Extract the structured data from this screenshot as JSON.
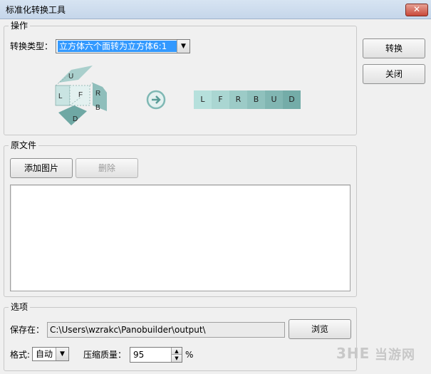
{
  "window": {
    "title": "标准化转换工具",
    "close_glyph": "✕"
  },
  "operation": {
    "group_title": "操作",
    "type_label": "转换类型：",
    "type_value": "立方体六个面转为立方体6:1",
    "cube_faces": {
      "up": "U",
      "left": "L",
      "front": "F",
      "right": "R",
      "back": "B",
      "down": "D"
    },
    "arrow_icon": "arrow-right-circle-icon",
    "strip_faces": [
      "L",
      "F",
      "R",
      "B",
      "U",
      "D"
    ],
    "strip_colors": [
      "#b6e0dc",
      "#aad6d2",
      "#9ccbc7",
      "#8fc1bd",
      "#81b6b2",
      "#74aca8"
    ]
  },
  "side_buttons": {
    "convert": "转换",
    "close": "关闭"
  },
  "source": {
    "group_title": "原文件",
    "add_label": "添加图片",
    "delete_label": "删除"
  },
  "options": {
    "group_title": "选项",
    "save_label": "保存在：",
    "save_path": "C:\\Users\\wzrakc\\Panobuilder\\output\\",
    "browse_label": "浏览",
    "format_label": "格式:",
    "format_value": "自动",
    "quality_label": "压缩质量：",
    "quality_value": "95",
    "quality_unit": "%"
  },
  "watermark": {
    "text": "3HE",
    "brand": "当游网"
  }
}
